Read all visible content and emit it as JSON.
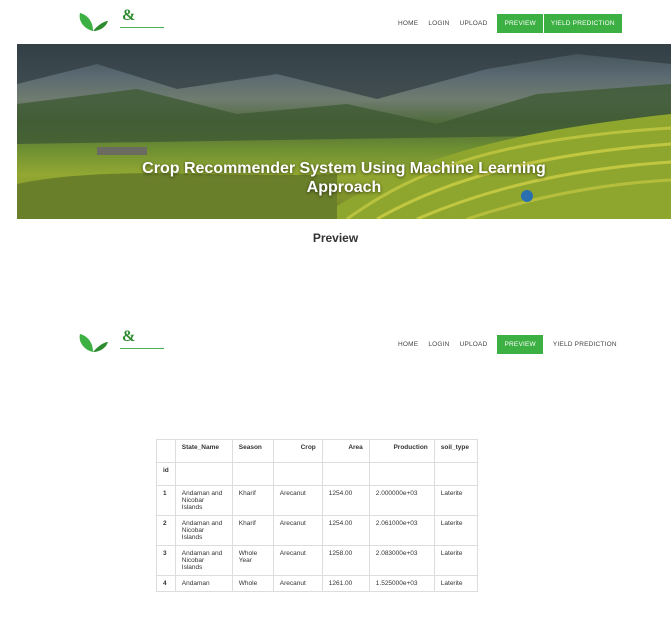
{
  "nav": {
    "logo_letter": "&",
    "items": [
      "HOME",
      "LOGIN",
      "UPLOAD",
      "PREVIEW",
      "YIELD PREDICTION"
    ]
  },
  "hero": {
    "title_line1": "Crop Recommender System Using Machine Learning",
    "title_line2": "Approach"
  },
  "page_heading": "Preview",
  "table": {
    "columns": [
      "",
      "State_Name",
      "Season",
      "Crop",
      "Area",
      "Production",
      "soil_type"
    ],
    "index_label": "id",
    "rows": [
      [
        "1",
        "Andaman and Nicobar Islands",
        "Kharif",
        "Arecanut",
        "1254.00",
        "2.000000e+03",
        "Laterite"
      ],
      [
        "2",
        "Andaman and Nicobar Islands",
        "Kharif",
        "Arecanut",
        "1254.00",
        "2.061000e+03",
        "Laterite"
      ],
      [
        "3",
        "Andaman and Nicobar Islands",
        "Whole Year",
        "Arecanut",
        "1258.00",
        "2.083000e+03",
        "Laterite"
      ],
      [
        "4",
        "Andaman",
        "Whole",
        "Arecanut",
        "1261.00",
        "1.525000e+03",
        "Laterite"
      ]
    ]
  },
  "colors": {
    "accent": "#3cb043"
  }
}
